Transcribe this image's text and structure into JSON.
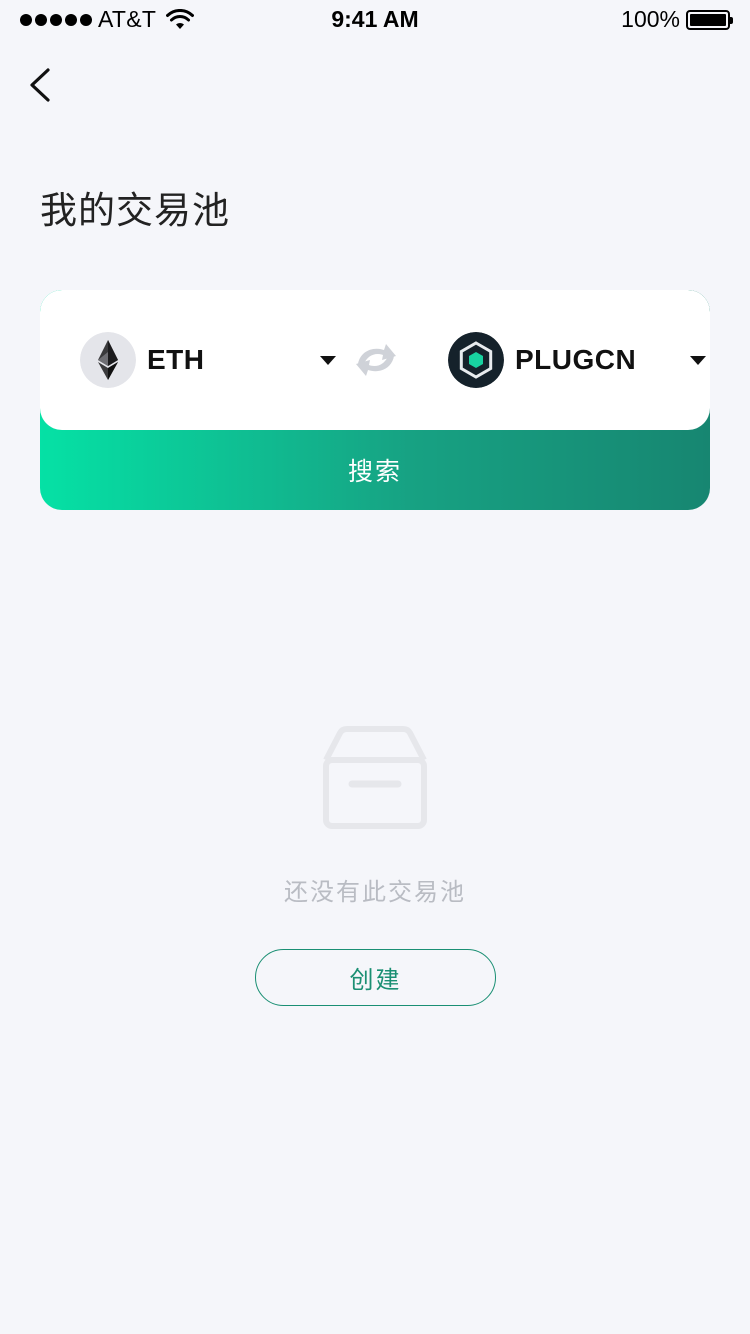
{
  "status_bar": {
    "carrier": "AT&T",
    "time": "9:41 AM",
    "battery": "100%"
  },
  "header": {
    "back_icon": "chevron-left-icon",
    "title": "我的交易池"
  },
  "pair_selector": {
    "token_a": {
      "symbol": "ETH",
      "icon": "ethereum-logo"
    },
    "token_b": {
      "symbol": "PLUGCN",
      "icon": "plugcn-logo"
    },
    "swap_icon": "swap-arrows-icon",
    "search_label": "搜索",
    "gradient_start": "#05e1a5",
    "gradient_end": "#178671"
  },
  "empty_state": {
    "icon": "empty-box-icon",
    "message": "还没有此交易池",
    "create_label": "创建"
  },
  "colors": {
    "background": "#f5f6fa",
    "accent": "#1a8f73",
    "muted_text": "#b9bcc3"
  }
}
